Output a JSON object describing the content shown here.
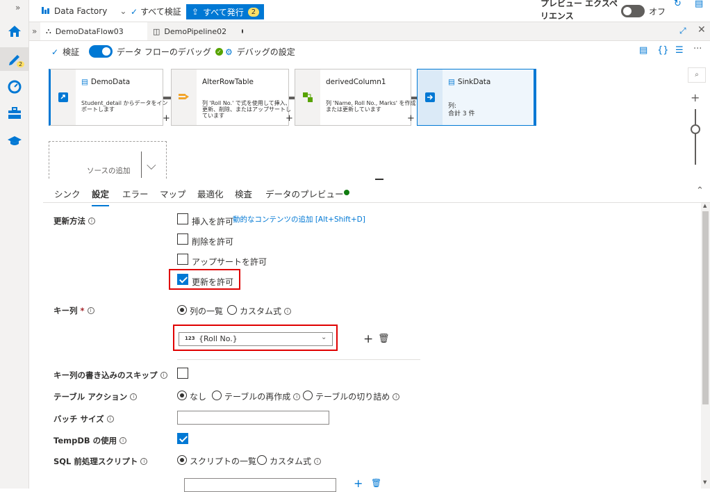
{
  "topbar": {
    "app_title": "Data Factory",
    "validate_all": "すべて検証",
    "publish_all": "すべて発行",
    "publish_count": "2",
    "preview_label_1": "プレビュー エクスペ",
    "preview_label_2": "リエンス",
    "toggle_state": "オフ"
  },
  "rail": {
    "edit_badge": "2"
  },
  "tabs": [
    {
      "label": "DemoDataFlow03"
    },
    {
      "label": "DemoPipeline02"
    }
  ],
  "toolbar": {
    "validate": "検証",
    "debug_label": "データ フローのデバッグ",
    "debug_settings": "デバッグの設定"
  },
  "canvas": {
    "nodes": [
      {
        "title": "DemoData",
        "desc": "Student_detail からデータをインポートします"
      },
      {
        "title": "AlterRowTable",
        "desc": "列 'Roll No.' で式を使用して挿入、更新、削除、またはアップサートしています"
      },
      {
        "title": "derivedColumn1",
        "desc": "列 'Name, Roll No., Marks' を作成または更新しています"
      },
      {
        "title": "SinkData",
        "desc_line1": "列:",
        "desc_line2": "合計 3 件"
      }
    ],
    "add_source": "ソースの追加"
  },
  "config_tabs": [
    "シンク",
    "設定",
    "エラー",
    "マップ",
    "最適化",
    "検査",
    "データのプレビュー"
  ],
  "form": {
    "update_method": {
      "label": "更新方法",
      "allow_insert": "挿入を許可",
      "dynamic_content": "動的なコンテンツの追加 [Alt+Shift+D]",
      "allow_delete": "削除を許可",
      "allow_upsert": "アップサートを許可",
      "allow_update": "更新を許可"
    },
    "key_columns": {
      "label": "キー列",
      "required": "*",
      "opt_list": "列の一覧",
      "opt_custom": "カスタム式",
      "type_tag": "123",
      "value": "{Roll No.}"
    },
    "skip_writing_keys": {
      "label": "キー列の書き込みのスキップ"
    },
    "table_action": {
      "label": "テーブル アクション",
      "opt_none": "なし",
      "opt_recreate": "テーブルの再作成",
      "opt_truncate": "テーブルの切り詰め"
    },
    "batch_size": {
      "label": "バッチ サイズ",
      "value": ""
    },
    "use_tempdb": {
      "label": "TempDB の使用"
    },
    "pre_sql": {
      "label": "SQL 前処理スクリプト",
      "opt_list": "スクリプトの一覧",
      "opt_custom": "カスタム式"
    }
  }
}
